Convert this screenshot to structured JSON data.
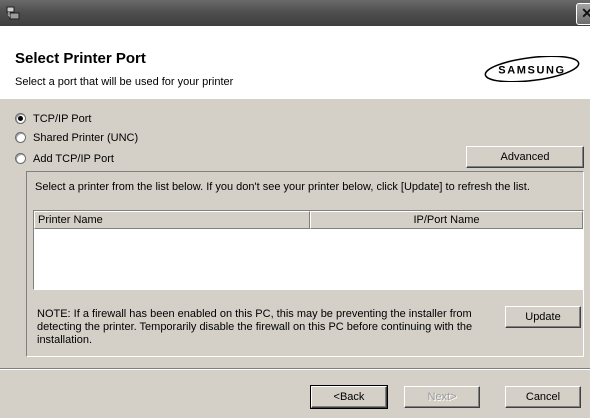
{
  "window": {
    "title_icon": "installer-icon",
    "close_label": "✕"
  },
  "header": {
    "title": "Select Printer Port",
    "subtitle": "Select a port that will be used for your printer",
    "logo_text": "SAMSUNG"
  },
  "port_options": [
    {
      "label": "TCP/IP Port",
      "checked": true
    },
    {
      "label": "Shared Printer (UNC)",
      "checked": false
    },
    {
      "label": "Add TCP/IP Port",
      "checked": false
    }
  ],
  "advanced_label": "Advanced",
  "instruction": "Select a printer from the list below. If you don't see your printer below, click [Update] to refresh the list.",
  "printer_list": {
    "columns": [
      "Printer Name",
      "IP/Port Name"
    ],
    "rows": []
  },
  "note": "NOTE: If a firewall has been enabled on this PC, this may be preventing the installer from detecting the printer. Temporarily disable the firewall on this PC before continuing with the installation.",
  "update_label": "Update",
  "footer": {
    "back_label": "<Back",
    "next_label": "Next>",
    "cancel_label": "Cancel"
  }
}
